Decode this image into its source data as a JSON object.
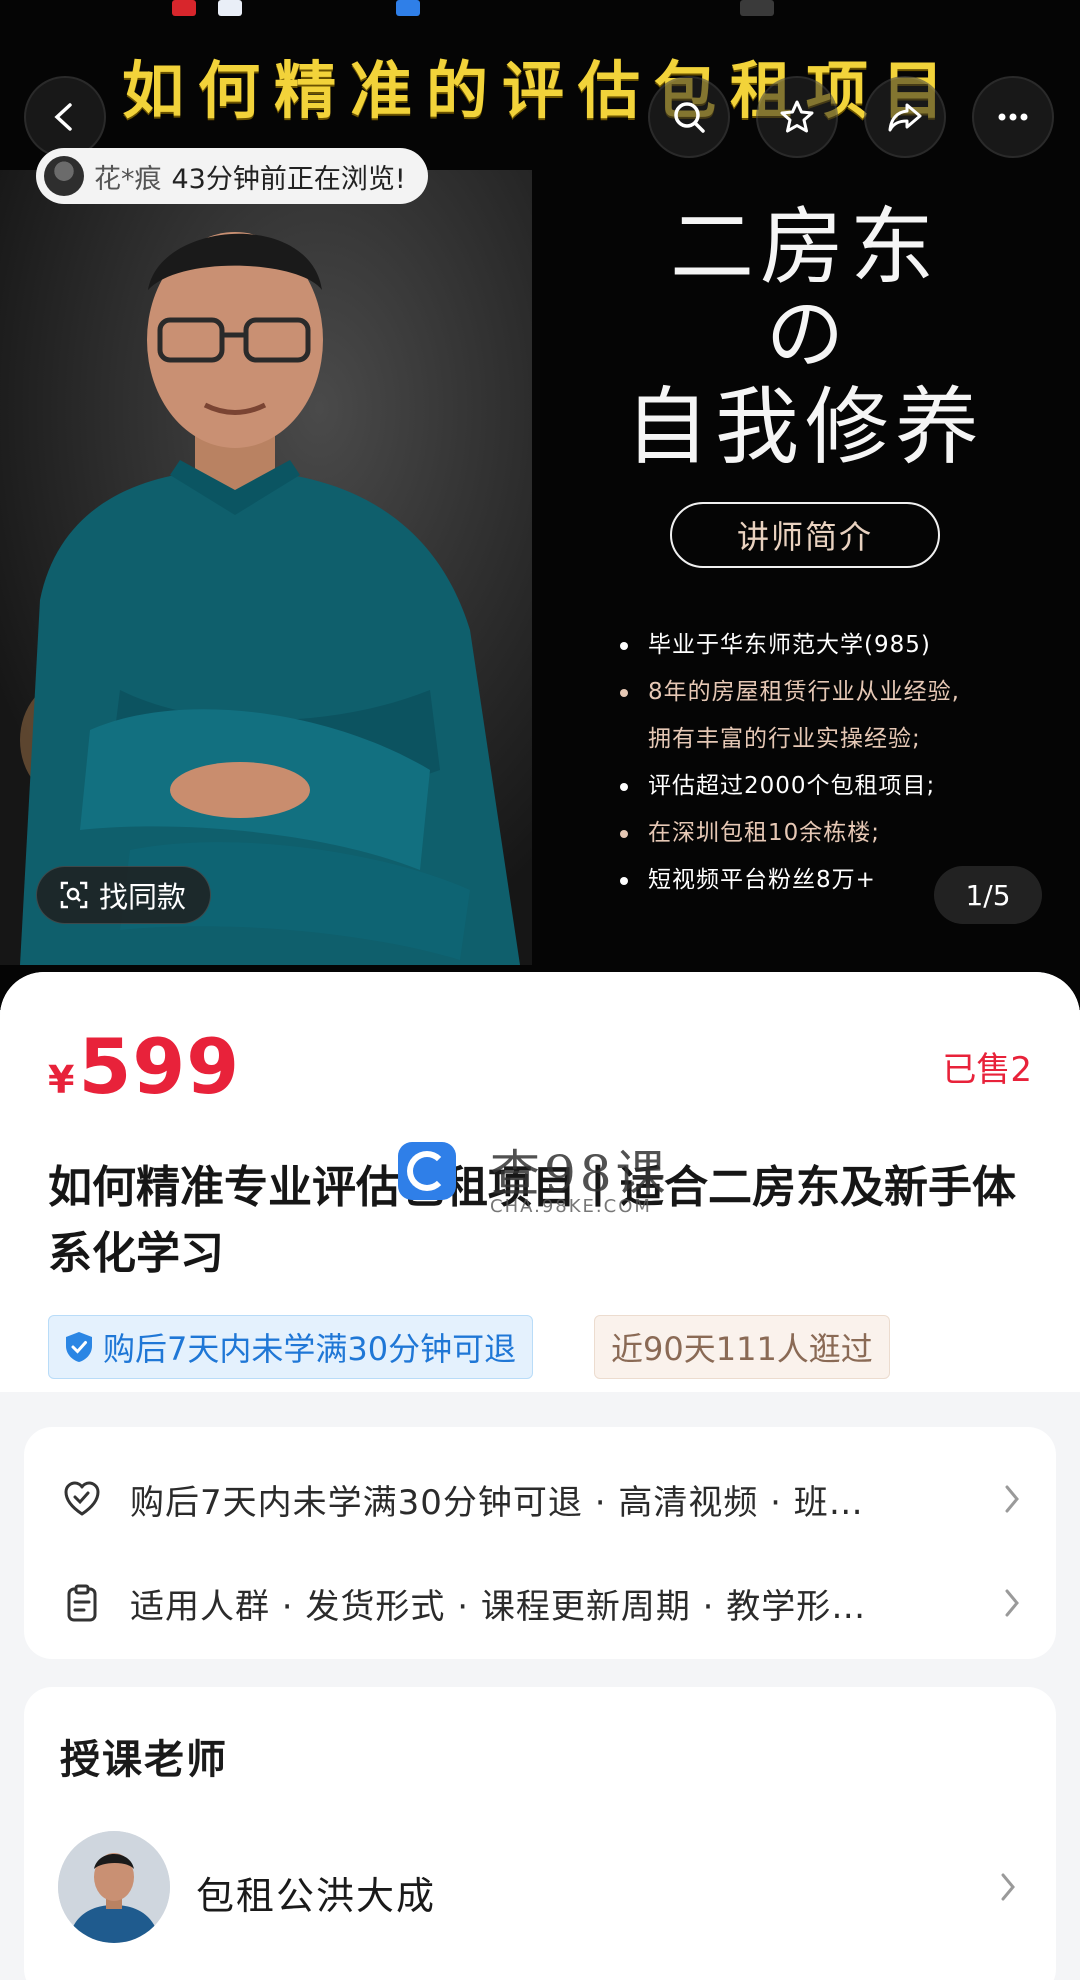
{
  "hero": {
    "headline": "如何精准的评估包租项目",
    "viewer_notice": {
      "name": "花*痕",
      "text": "43分钟前正在浏览!"
    },
    "promo": {
      "title_line1": "二房东",
      "title_line2": "の",
      "title_line3": "自我修养",
      "pill_label": "讲师简介",
      "bullets": [
        "毕业于华东师范大学(985)",
        "8年的房屋租赁行业从业经验,",
        "拥有丰富的行业实操经验;",
        "评估超过2000个包租项目;",
        "在深圳包租10余栋楼;",
        "短视频平台粉丝8万+"
      ]
    },
    "find_similar_label": "找同款",
    "page_counter": "1/5"
  },
  "nav": {
    "icons": [
      "back-icon",
      "search-icon",
      "star-icon",
      "share-icon",
      "more-icon"
    ]
  },
  "product": {
    "currency": "¥",
    "price": "599",
    "sold": "已售2",
    "title": "如何精准专业评估包租项目丨适合二房东及新手体系化学习",
    "refund_tag": "购后7天内未学满30分钟可退",
    "visits_tag": "近90天111人逛过"
  },
  "watermark": {
    "cn": "查98课",
    "en": "CHA.98KE.COM"
  },
  "services": [
    {
      "icon": "heart-shield-icon",
      "text": "购后7天内未学满30分钟可退 · 高清视频 · 班…"
    },
    {
      "icon": "clipboard-icon",
      "text": "适用人群 · 发货形式 · 课程更新周期 · 教学形…"
    }
  ],
  "teacher": {
    "heading": "授课老师",
    "name": "包租公洪大成"
  },
  "colors": {
    "price_red": "#e8223a",
    "headline_yellow": "#f2d33a",
    "refund_blue": "#1f77d6",
    "promo_accent": "#e6c8b5"
  }
}
